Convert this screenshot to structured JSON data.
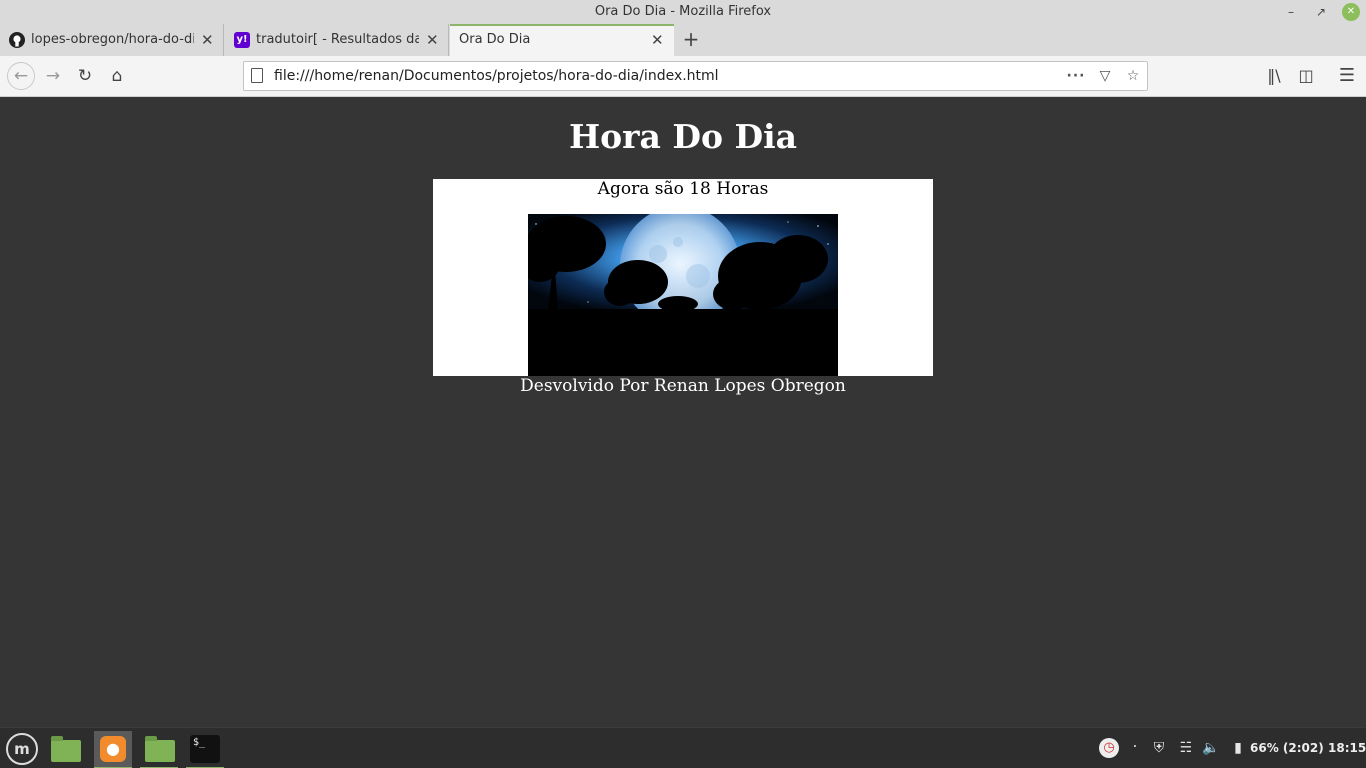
{
  "window": {
    "title": "Ora Do Dia - Mozilla Firefox"
  },
  "tabs": [
    {
      "label": "lopes-obregon/hora-do-dia",
      "favicon": "github-icon"
    },
    {
      "label": "tradutoir[ - Resultados da b",
      "favicon": "yahoo-icon"
    },
    {
      "label": "Ora Do Dia",
      "active": true
    }
  ],
  "navbar": {
    "url": "file:///home/renan/Documentos/projetos/hora-do-dia/index.html"
  },
  "page": {
    "heading": "Hora Do Dia",
    "hour_text": "Agora são 18 Horas",
    "footer": "Desvolvido Por Renan Lopes Obregon",
    "card_background": "#ffffff",
    "page_background": "#353535"
  },
  "taskbar": {
    "battery": "66% (2:02)",
    "clock": "18:15"
  },
  "colors": {
    "accent": "#8cb56a",
    "folder": "#7fb356",
    "firefox": "#f28b2c"
  }
}
